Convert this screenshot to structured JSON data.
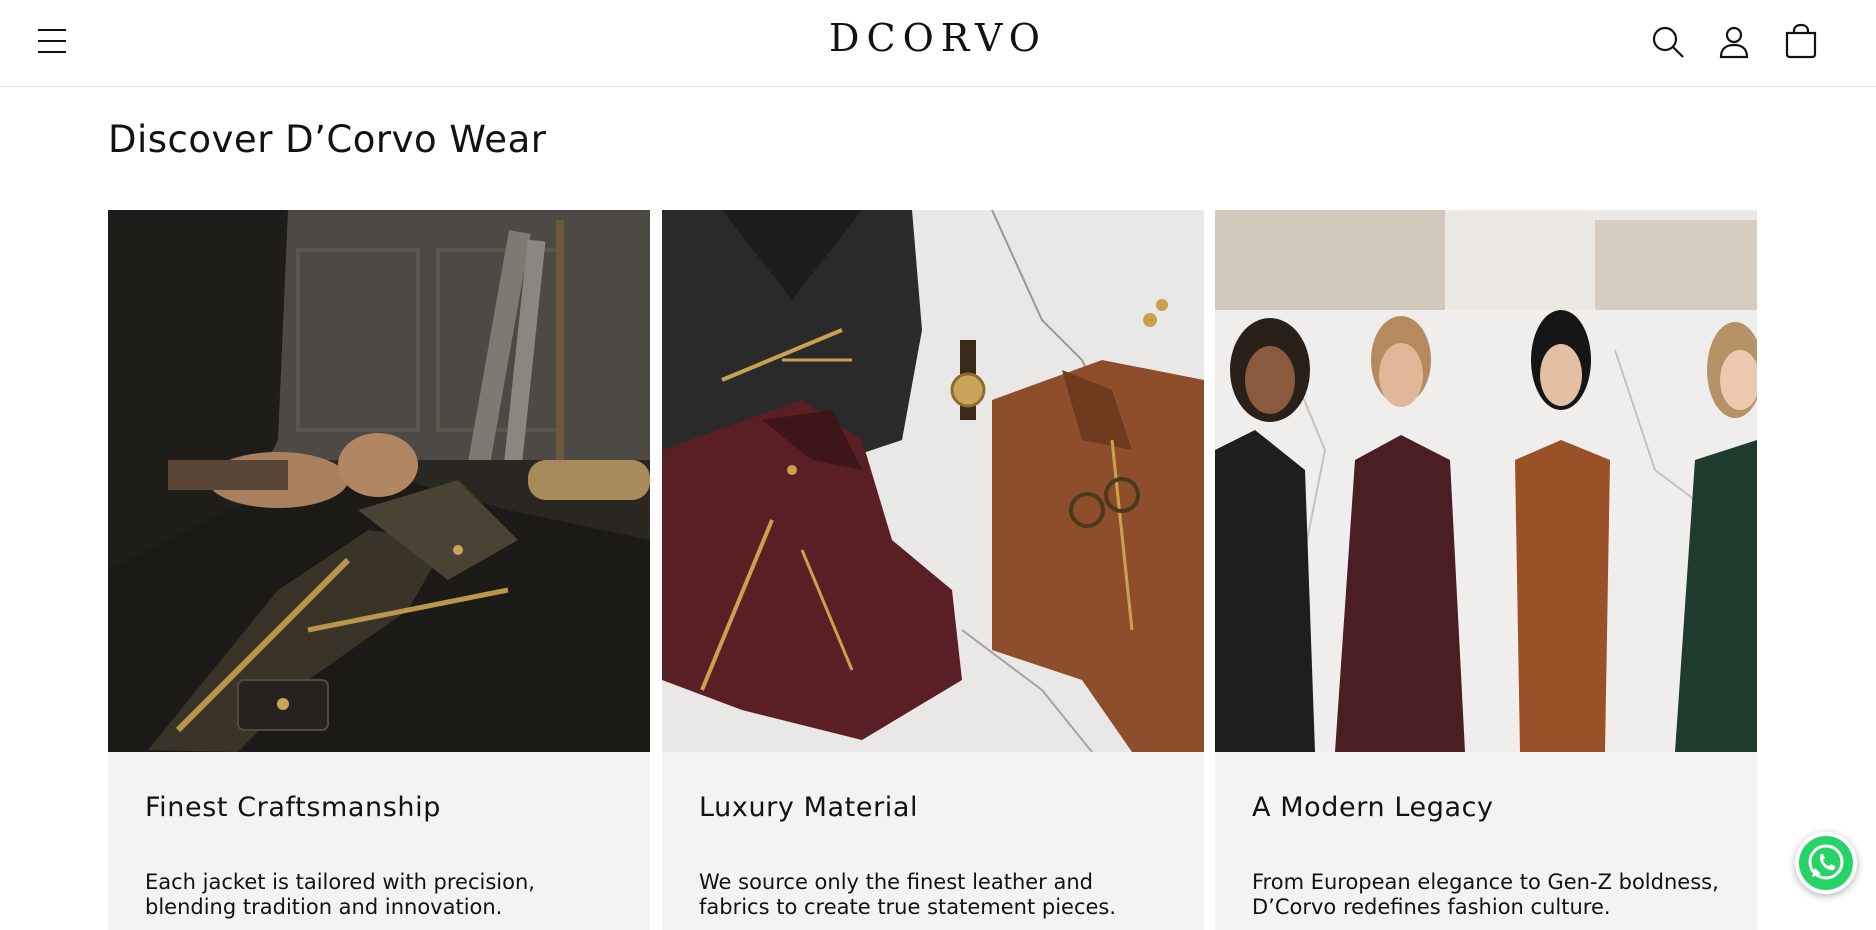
{
  "header": {
    "logo": "DCORVO",
    "icons": [
      "menu-icon",
      "search-icon",
      "account-icon",
      "cart-icon"
    ]
  },
  "section": {
    "title": "Discover D’Corvo Wear"
  },
  "cards": [
    {
      "title": "Finest Craftsmanship",
      "text": "Each jacket is tailored with precision, blending tradition and innovation."
    },
    {
      "title": "Luxury Material",
      "text": "We source only the finest leather and fabrics to create true statement pieces."
    },
    {
      "title": "A Modern Legacy",
      "text": "From European elegance to Gen-Z boldness, D’Corvo redefines fashion culture."
    }
  ],
  "floating": {
    "icon": "whatsapp-icon"
  },
  "colors": {
    "text": "#121212",
    "card_bg": "#f3f3f3",
    "whatsapp": "#25d366",
    "border": "#e8e8e8"
  }
}
